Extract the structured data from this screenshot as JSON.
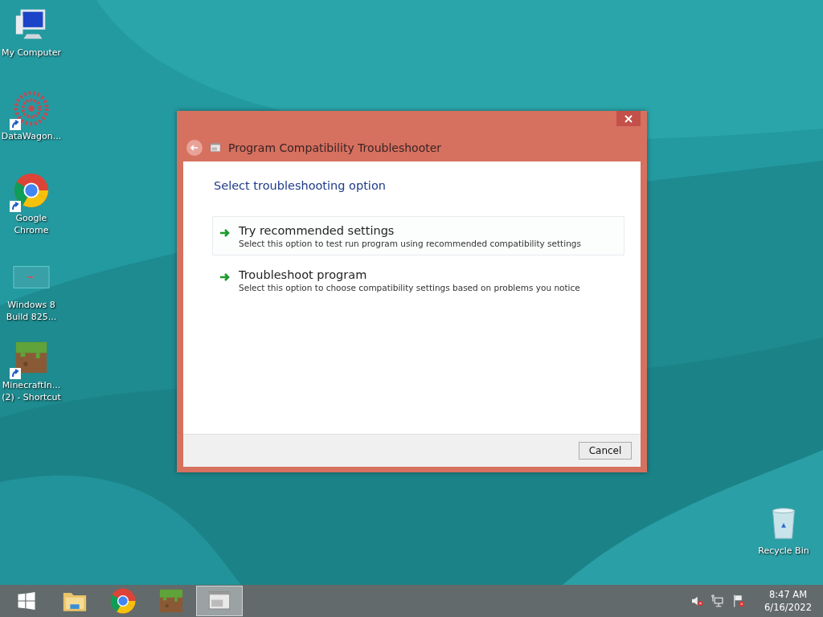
{
  "desktop_icons": [
    {
      "label": "My Computer",
      "kind": "computer",
      "shortcut": false
    },
    {
      "label": "DataWagon...",
      "kind": "flower",
      "shortcut": true
    },
    {
      "label": "Google Chrome",
      "kind": "chrome",
      "shortcut": true
    },
    {
      "label": "Windows 8 Build 825...",
      "kind": "screen",
      "shortcut": false
    },
    {
      "label": "MinecraftIn... (2) - Shortcut",
      "kind": "grass",
      "shortcut": true
    },
    {
      "label": "Recycle Bin",
      "kind": "bin",
      "shortcut": false
    }
  ],
  "window": {
    "title": "Program Compatibility Troubleshooter",
    "heading": "Select troubleshooting option",
    "options": [
      {
        "title": "Try recommended settings",
        "description": "Select this option to test run program using recommended compatibility settings",
        "selected": true
      },
      {
        "title": "Troubleshoot program",
        "description": "Select this option to choose compatibility settings based on problems you notice",
        "selected": false
      }
    ],
    "buttons": [
      "Cancel"
    ]
  },
  "taskbar": {
    "items": [
      {
        "kind": "start",
        "selected": false
      },
      {
        "kind": "folder",
        "selected": false
      },
      {
        "kind": "chrome",
        "selected": false
      },
      {
        "kind": "grass",
        "selected": false
      },
      {
        "kind": "app",
        "selected": true
      }
    ],
    "tray": [
      {
        "kind": "speaker"
      },
      {
        "kind": "network"
      },
      {
        "kind": "flag"
      }
    ],
    "time": "8:47 AM",
    "date": "6/16/2022"
  }
}
